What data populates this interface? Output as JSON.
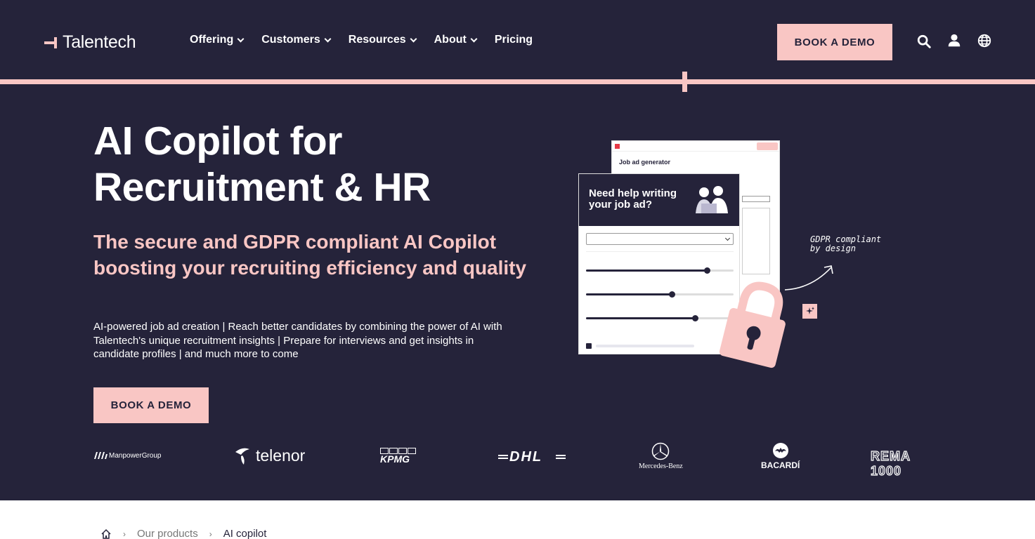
{
  "brand": {
    "name": "Talentech"
  },
  "nav": {
    "items": [
      {
        "label": "Offering",
        "has_dropdown": true
      },
      {
        "label": "Customers",
        "has_dropdown": true
      },
      {
        "label": "Resources",
        "has_dropdown": true
      },
      {
        "label": "About",
        "has_dropdown": true
      },
      {
        "label": "Pricing",
        "has_dropdown": false
      }
    ],
    "cta_label": "BOOK A DEMO",
    "icons": [
      "search-icon",
      "user-icon",
      "globe-icon"
    ]
  },
  "hero": {
    "title_line1": "AI Copilot for",
    "title_line2": "Recruitment & HR",
    "subtitle": "The secure and GDPR compliant AI Copilot boosting your recruiting efficiency and quality",
    "description": "AI-powered job ad creation | Reach better candidates by combining the power of AI with Talentech's unique recruitment insights | Prepare for interviews and get insights in candidate profiles | and much more to come",
    "cta_label": "BOOK A DEMO"
  },
  "illustration": {
    "back_window_title": "Job ad generator",
    "front_window_heading": "Need help writing your job ad?",
    "sliders": [
      0.82,
      0.58,
      0.74
    ],
    "note": "GDPR compliant by design"
  },
  "logos": [
    "ManpowerGroup",
    "telenor",
    "KPMG",
    "DHL",
    "Mercedes-Benz",
    "BACARDÍ",
    "REMA 1000"
  ],
  "breadcrumb": {
    "items": [
      "Our products",
      "AI copilot"
    ]
  },
  "colors": {
    "background": "#25233a",
    "accent": "#f9c6c4",
    "white": "#ffffff"
  }
}
